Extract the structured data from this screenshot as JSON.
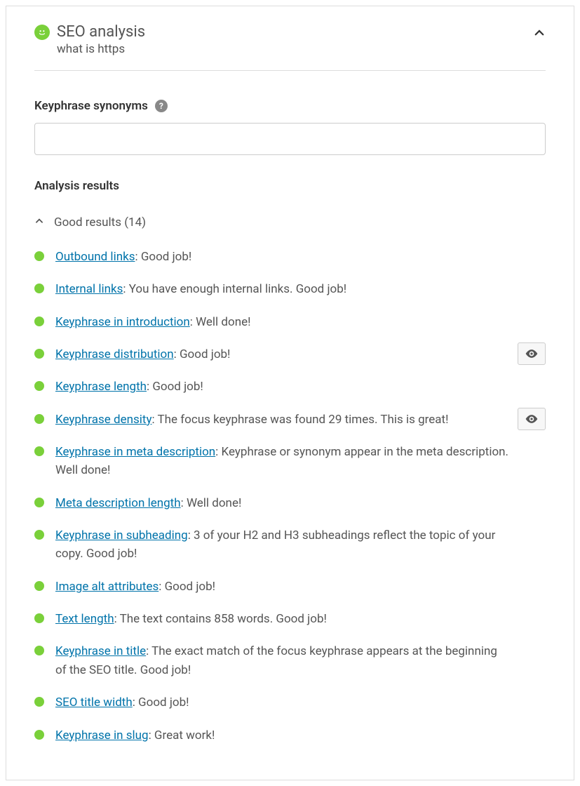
{
  "header": {
    "title": "SEO analysis",
    "subtitle": "what is https"
  },
  "synonyms": {
    "label": "Keyphrase synonyms",
    "value": ""
  },
  "analysis": {
    "title": "Analysis results",
    "group_label": "Good results (14)"
  },
  "results": [
    {
      "link": "Outbound links",
      "text": ": Good job!",
      "eye": false
    },
    {
      "link": "Internal links",
      "text": ": You have enough internal links. Good job!",
      "eye": false
    },
    {
      "link": "Keyphrase in introduction",
      "text": ": Well done!",
      "eye": false
    },
    {
      "link": "Keyphrase distribution",
      "text": ": Good job!",
      "eye": true
    },
    {
      "link": "Keyphrase length",
      "text": ": Good job!",
      "eye": false
    },
    {
      "link": "Keyphrase density",
      "text": ": The focus keyphrase was found 29 times. This is great!",
      "eye": true
    },
    {
      "link": "Keyphrase in meta description",
      "text": ": Keyphrase or synonym appear in the meta description. Well done!",
      "eye": false
    },
    {
      "link": "Meta description length",
      "text": ": Well done!",
      "eye": false
    },
    {
      "link": "Keyphrase in subheading",
      "text": ": 3 of your H2 and H3 subheadings reflect the topic of your copy. Good job!",
      "eye": false
    },
    {
      "link": "Image alt attributes",
      "text": ": Good job!",
      "eye": false
    },
    {
      "link": "Text length",
      "text": ": The text contains 858 words. Good job!",
      "eye": false
    },
    {
      "link": "Keyphrase in title",
      "text": ": The exact match of the focus keyphrase appears at the beginning of the SEO title. Good job!",
      "eye": false
    },
    {
      "link": "SEO title width",
      "text": ": Good job!",
      "eye": false
    },
    {
      "link": "Keyphrase in slug",
      "text": ": Great work!",
      "eye": false
    }
  ]
}
